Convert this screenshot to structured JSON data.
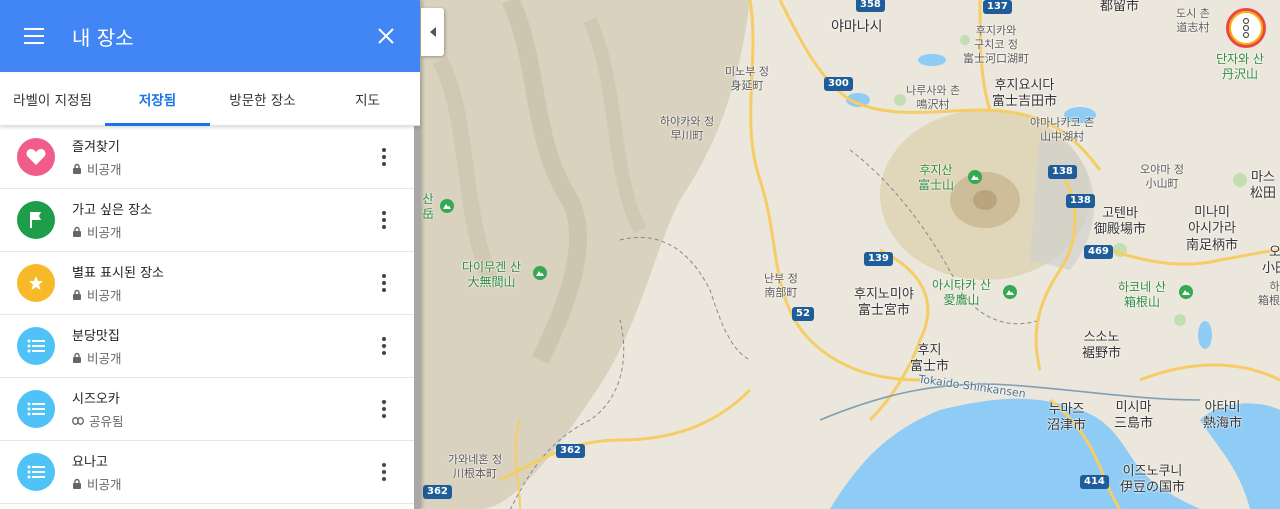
{
  "panel": {
    "title": "내 장소",
    "tabs": [
      {
        "label": "라벨이 지정됨"
      },
      {
        "label": "저장됨"
      },
      {
        "label": "방문한 장소"
      },
      {
        "label": "지도"
      }
    ],
    "items": [
      {
        "name": "즐겨찾기",
        "status": "비공개",
        "icon": "heart-icon",
        "color": "#f25c8a"
      },
      {
        "name": "가고 싶은 장소",
        "status": "비공개",
        "icon": "flag-icon",
        "color": "#1e9e4a"
      },
      {
        "name": "별표 표시된 장소",
        "status": "비공개",
        "icon": "star-icon",
        "color": "#f7b928"
      },
      {
        "name": "분당맛집",
        "status": "비공개",
        "icon": "list-icon",
        "color": "#4fc3f7"
      },
      {
        "name": "시즈오카",
        "status": "공유됨",
        "icon": "list-icon",
        "color": "#4fc3f7"
      },
      {
        "name": "요나고",
        "status": "비공개",
        "icon": "list-icon",
        "color": "#4fc3f7"
      }
    ]
  },
  "map": {
    "labels": {
      "yamanashi": "야마나시",
      "minobu": "미노부 정",
      "minobu_jp": "身延町",
      "hayakawa": "하야카와 정",
      "hayakawa_jp": "早川町",
      "daimugen": "다이무겐 산",
      "daimugen_jp": "大無間山",
      "nanbu": "난부 정",
      "nanbu_jp": "南部町",
      "kawanehon": "가와네혼 정",
      "kawanehon_jp": "川根本町",
      "fujikawaguchiko": "후지카와",
      "fujikawaguchiko2": "구치코 정",
      "fujikawaguchiko_jp": "富士河口湖町",
      "narusawa": "나루사와 촌",
      "narusawa_jp": "鳴沢村",
      "fujiyoshida": "후지요시다",
      "fujiyoshida_jp": "富士吉田市",
      "yamanakako": "야마나카코 촌",
      "yamanakako_jp": "山中湖村",
      "mtfuji": "후지산",
      "mtfuji_jp": "富士山",
      "oyama": "오야마 정",
      "oyama_jp": "小山町",
      "gotemba": "고텐바",
      "gotemba_jp": "御殿場市",
      "minamiashigara": "미나미",
      "minamiashigara2": "아시가라",
      "minamiashigara_jp": "南足柄市",
      "fujinomiya": "후지노미야",
      "fujinomiya_jp": "富士宮市",
      "ashitaka": "아시타카 산",
      "ashitaka_jp": "愛鷹山",
      "hakone": "하코네 산",
      "hakone_jp": "箱根山",
      "fuji": "후지",
      "fuji_jp": "富士市",
      "susono": "스소노",
      "susono_jp": "裾野市",
      "numazu": "누마즈",
      "numazu_jp": "沼津市",
      "mishima": "미시마",
      "mishima_jp": "三島市",
      "atami": "아타미",
      "atami_jp": "熱海市",
      "izunokuni": "이즈노쿠니",
      "izunokuni_jp": "伊豆の国市",
      "tanzawa": "단자와 산",
      "tanzawa_jp": "丹沢山",
      "tsuru": "都留市",
      "doshi": "도시 촌",
      "doshi_jp": "道志村",
      "matsuda": "마스",
      "matsuda_jp": "松田",
      "odawara": "오",
      "odawara_jp": "小田",
      "hakonemachi": "하",
      "hakonemachi_jp": "箱根町",
      "shinkansen": "Tokaido Shinkansen",
      "left_san": "산",
      "left_san_jp": "岳"
    },
    "roads": [
      "137",
      "358",
      "300",
      "139",
      "138",
      "138",
      "469",
      "52",
      "362",
      "362",
      "414"
    ]
  }
}
